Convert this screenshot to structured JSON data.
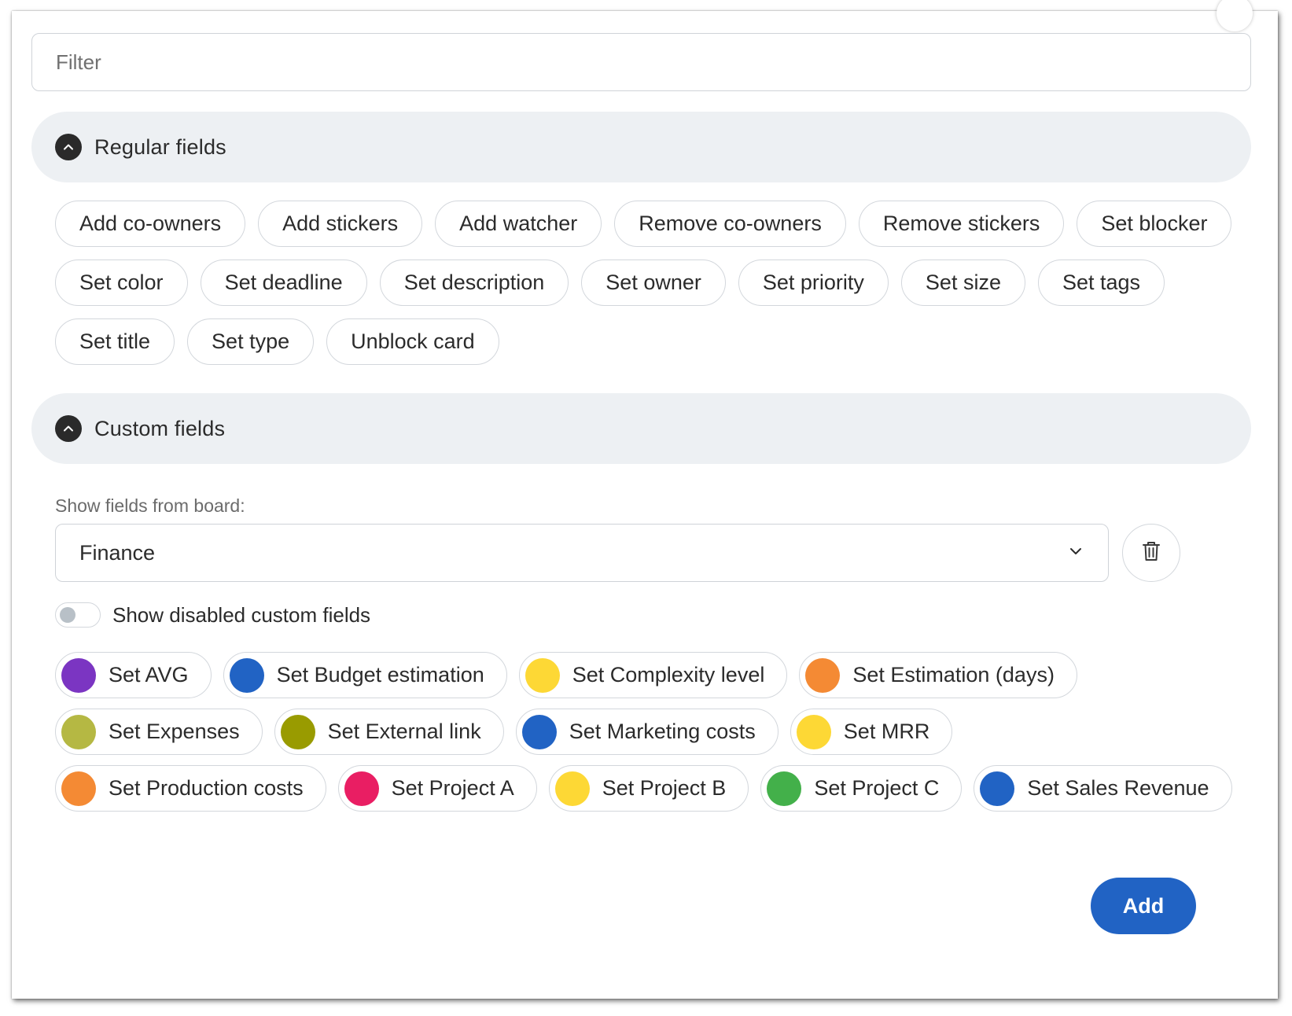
{
  "filter": {
    "placeholder": "Filter",
    "value": ""
  },
  "regular_section": {
    "title": "Regular fields",
    "chips": [
      "Add co-owners",
      "Add stickers",
      "Add watcher",
      "Remove co-owners",
      "Remove stickers",
      "Set blocker",
      "Set color",
      "Set deadline",
      "Set description",
      "Set owner",
      "Set priority",
      "Set size",
      "Set tags",
      "Set title",
      "Set type",
      "Unblock card"
    ]
  },
  "custom_section": {
    "title": "Custom fields",
    "show_label": "Show fields from board:",
    "board_select": {
      "value": "Finance"
    },
    "toggle": {
      "label": "Show disabled custom fields",
      "on": false
    },
    "chips": [
      {
        "label": "Set AVG",
        "color": "#7b35c2"
      },
      {
        "label": "Set Budget estimation",
        "color": "#2163c4"
      },
      {
        "label": "Set Complexity level",
        "color": "#fdd835"
      },
      {
        "label": "Set Estimation (days)",
        "color": "#f48a34"
      },
      {
        "label": "Set Expenses",
        "color": "#b5b843"
      },
      {
        "label": "Set External link",
        "color": "#999b00"
      },
      {
        "label": "Set Marketing costs",
        "color": "#2163c4"
      },
      {
        "label": "Set MRR",
        "color": "#fdd835"
      },
      {
        "label": "Set Production costs",
        "color": "#f48a34"
      },
      {
        "label": "Set Project A",
        "color": "#e91e63"
      },
      {
        "label": "Set Project B",
        "color": "#fdd835"
      },
      {
        "label": "Set Project C",
        "color": "#43b04a"
      },
      {
        "label": "Set Sales Revenue",
        "color": "#2163c4"
      }
    ]
  },
  "footer": {
    "add_label": "Add"
  },
  "icons": {
    "collapse": "chevron-up-icon",
    "dropdown": "chevron-down-icon",
    "delete": "trash-icon"
  }
}
